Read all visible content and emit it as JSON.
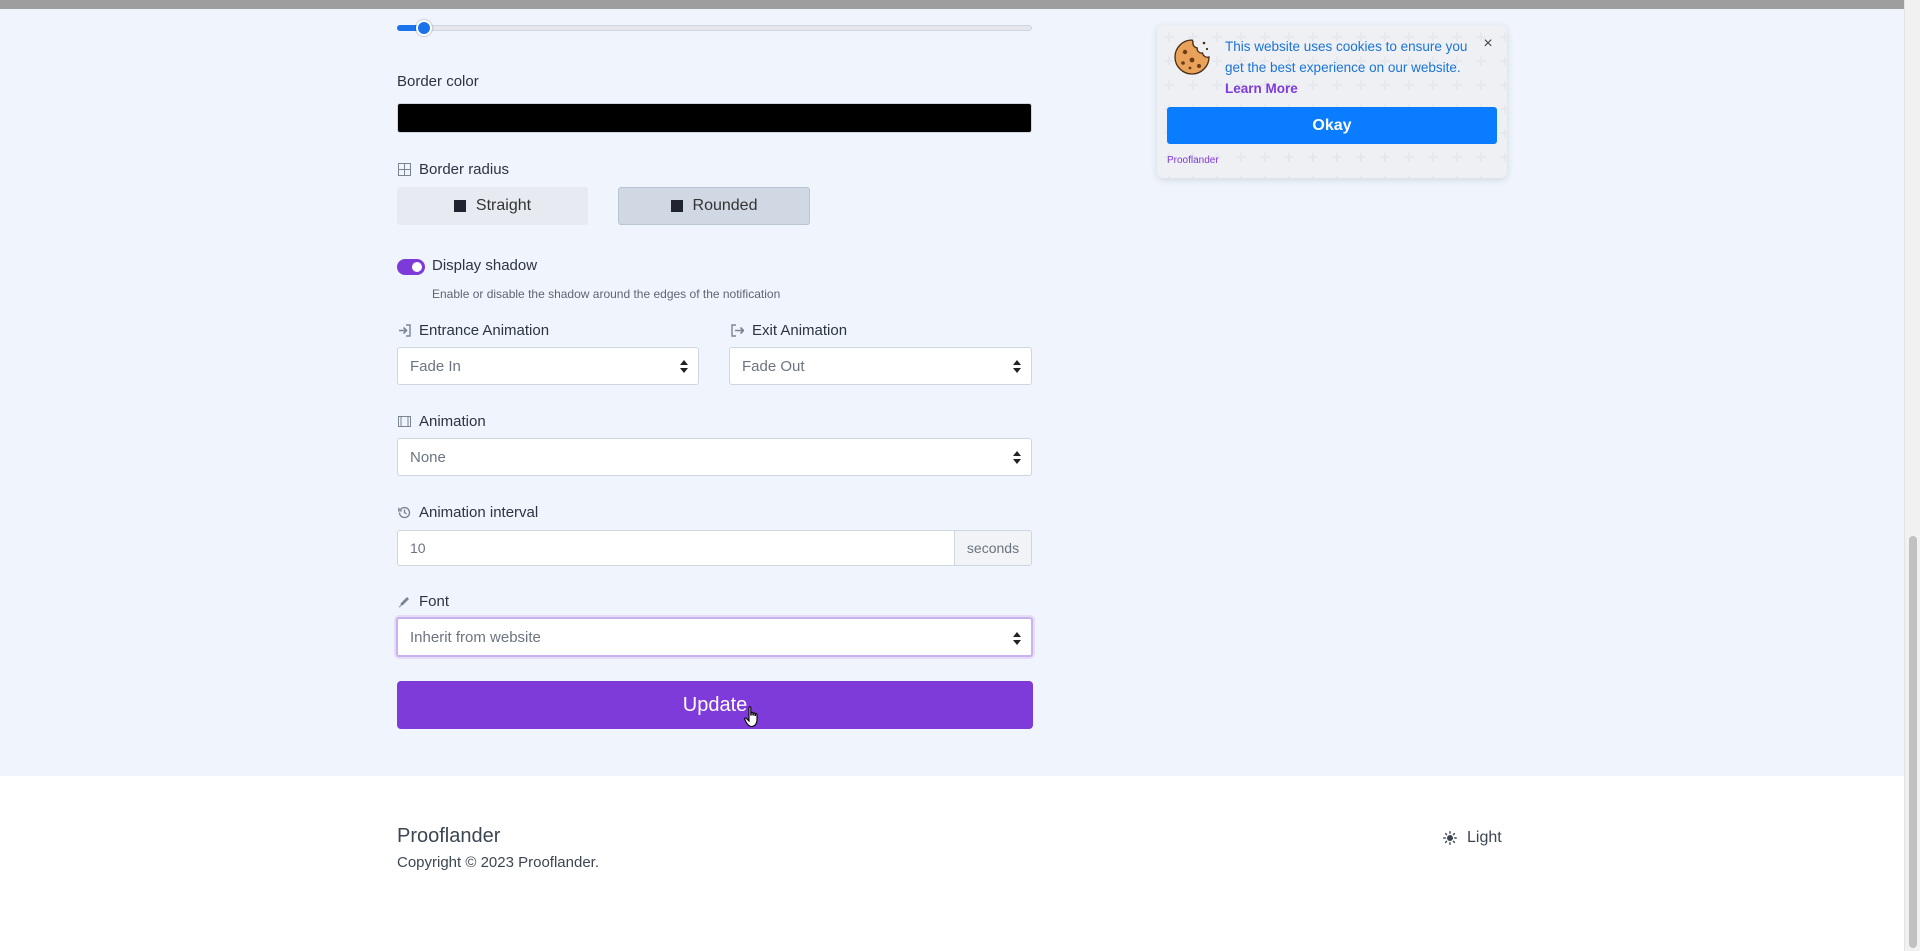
{
  "slider": {
    "value_fraction": 0.03
  },
  "border_color": {
    "label": "Border color",
    "value": "#000000"
  },
  "border_radius": {
    "label": "Border radius",
    "options": [
      "Straight",
      "Rounded"
    ],
    "selected": "Rounded"
  },
  "display_shadow": {
    "label": "Display shadow",
    "help": "Enable or disable the shadow around the edges of the notification",
    "enabled": true
  },
  "entrance_animation": {
    "label": "Entrance Animation",
    "value": "Fade In"
  },
  "exit_animation": {
    "label": "Exit Animation",
    "value": "Fade Out"
  },
  "animation": {
    "label": "Animation",
    "value": "None"
  },
  "animation_interval": {
    "label": "Animation interval",
    "value": "10",
    "unit": "seconds"
  },
  "font": {
    "label": "Font",
    "value": "Inherit from website"
  },
  "update_label": "Update",
  "cookie": {
    "text": "This website uses cookies to ensure you get the best experience on our website.",
    "link": "Learn More",
    "close": "×",
    "okay": "Okay",
    "brand": "Prooflander"
  },
  "footer": {
    "brand": "Prooflander",
    "copyright": "Copyright © 2023 Prooflander.",
    "theme": "Light"
  },
  "colors": {
    "accent": "#7e3bd9",
    "primary_blue": "#0a7cff",
    "page_bg": "#f0f5fd"
  }
}
